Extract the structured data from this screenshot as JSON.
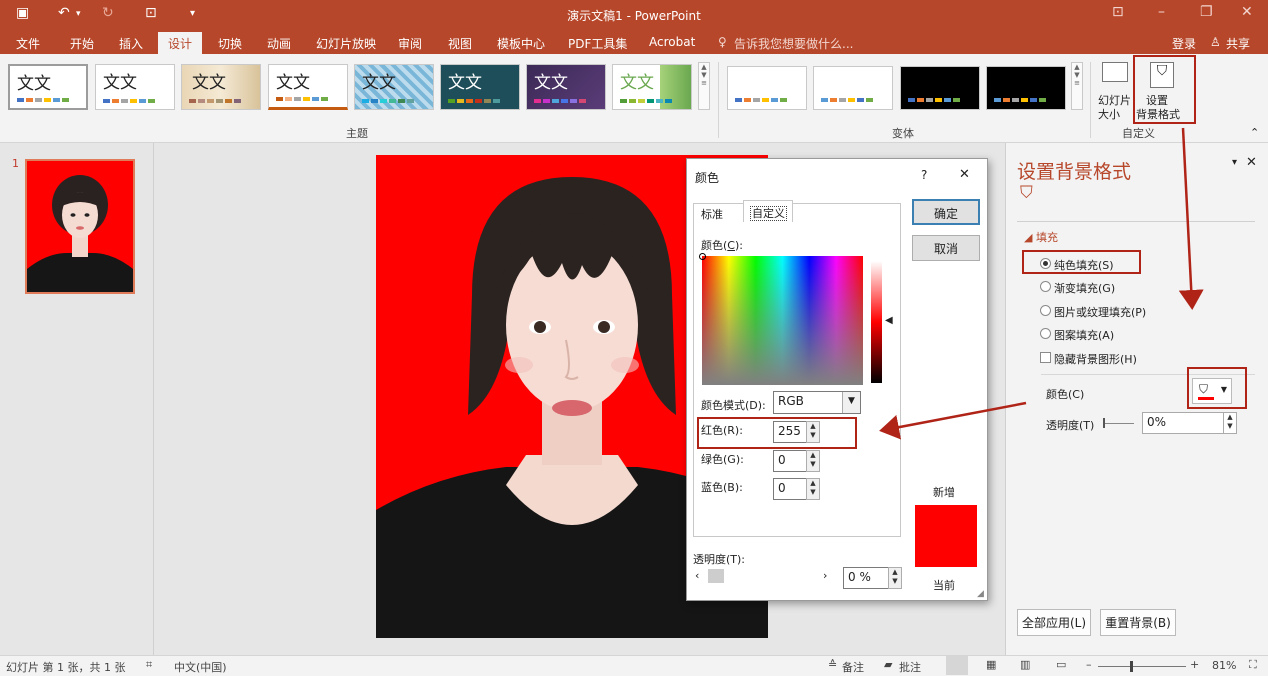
{
  "window": {
    "title": "演示文稿1 - PowerPoint"
  },
  "menu": {
    "items": [
      "文件",
      "开始",
      "插入",
      "设计",
      "切换",
      "动画",
      "幻灯片放映",
      "审阅",
      "视图",
      "模板中心",
      "PDF工具集",
      "Acrobat"
    ],
    "active": "设计",
    "tell_me": "告诉我您想要做什么...",
    "login": "登录",
    "share": "共享"
  },
  "ribbon": {
    "themes_label": "主题",
    "theme_text": "文文",
    "variants_label": "变体",
    "customize_label": "自定义",
    "slide_size_label": "幻灯片大小",
    "slide_size_line1": "幻灯片",
    "slide_size_line2": "大小",
    "format_bg_line1": "设置",
    "format_bg_line2": "背景格式"
  },
  "thumbs": {
    "slide_number": "1"
  },
  "color_dialog": {
    "title": "颜色",
    "help": "?",
    "tab_standard": "标准",
    "tab_custom": "自定义",
    "colors_label": "颜色(C):",
    "colors_label_pre": "颜色(",
    "colors_label_key": "C",
    "colors_label_post": "):",
    "ok": "确定",
    "cancel": "取消",
    "mode_label": "颜色模式(D):",
    "mode_value": "RGB",
    "red_label": "红色(R):",
    "red_value": "255",
    "green_label": "绿色(G):",
    "green_value": "0",
    "blue_label": "蓝色(B):",
    "blue_value": "0",
    "new_label": "新增",
    "current_label": "当前",
    "transparency_label": "透明度(T):",
    "transparency_value": "0 %",
    "new_color": "#ff0000",
    "current_color": "#ff0000"
  },
  "format_pane": {
    "title": "设置背景格式",
    "fill_header": "填充",
    "options": [
      "纯色填充(S)",
      "渐变填充(G)",
      "图片或纹理填充(P)",
      "图案填充(A)"
    ],
    "selected_option": "纯色填充(S)",
    "hide_bg_graphics": "隐藏背景图形(H)",
    "color_label": "颜色(C)",
    "transparency_label": "透明度(T)",
    "transparency_value": "0%",
    "apply_all": "全部应用(L)",
    "reset_bg": "重置背景(B)"
  },
  "status": {
    "slide_info": "幻灯片 第 1 张，共 1 张",
    "language": "中文(中国)",
    "notes": "备注",
    "comments": "批注",
    "zoom": "81%"
  },
  "colors": {
    "brand": "#b7472a",
    "slide_background": "#ff0000",
    "annotation": "#b02418"
  }
}
